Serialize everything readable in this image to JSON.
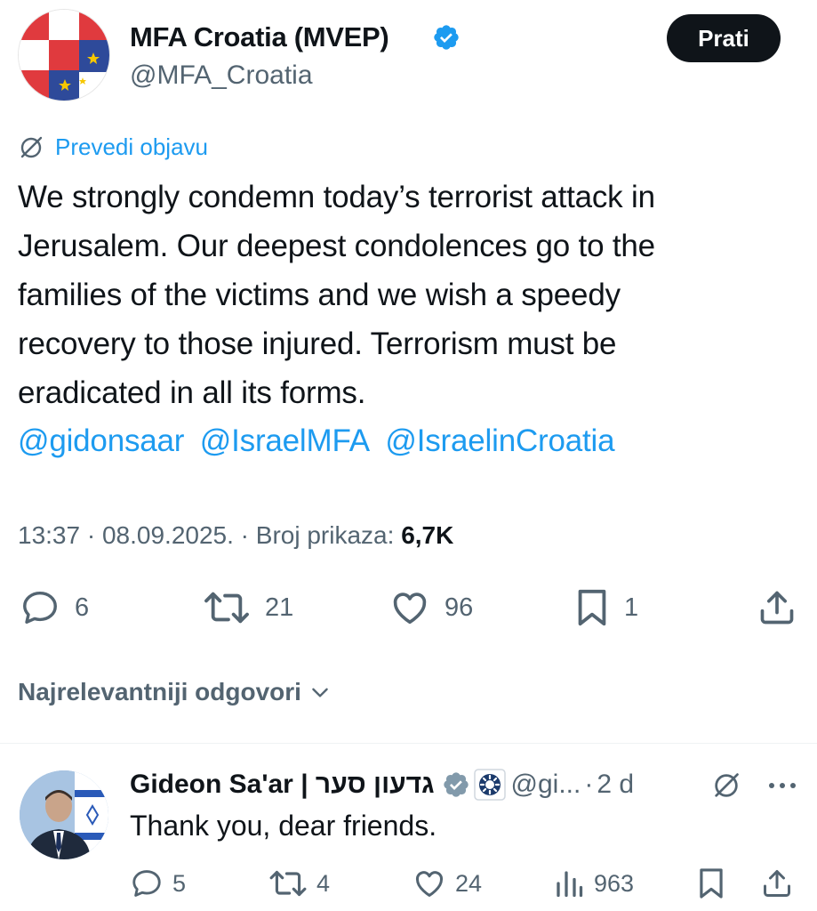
{
  "post": {
    "author_name": "MFA Croatia (MVEP)",
    "author_handle": "@MFA_Croatia",
    "follow_label": "Prati",
    "translate_label": "Prevedi objavu",
    "text_lines": [
      "We strongly condemn today’s terrorist attack in",
      "Jerusalem. Our deepest condolences go to the",
      "families of the victims and we wish a speedy",
      "recovery to those injured. Terrorism must be",
      "eradicated in all its forms."
    ],
    "mentions": [
      "@gidonsaar",
      "@IsraelMFA",
      "@IsraelinCroatia"
    ],
    "time": "13:37",
    "date": "08.09.2025.",
    "views_label": "Broj prikaza:",
    "views_count": "6,7K",
    "stats": {
      "replies": "6",
      "reposts": "21",
      "likes": "96",
      "bookmarks": "1"
    }
  },
  "replies_section": {
    "sort_label": "Najrelevantniji odgovori"
  },
  "reply": {
    "author_name": "Gideon Sa'ar | גדעון סער",
    "author_handle": "@gi...",
    "separator": "·",
    "time": "2 d",
    "text": "Thank you, dear friends.",
    "stats": {
      "replies": "5",
      "reposts": "4",
      "likes": "24",
      "views": "963"
    }
  },
  "colors": {
    "accent": "#1d9bf0",
    "text": "#0f1419",
    "secondary": "#536471",
    "button_bg": "#0f1419"
  }
}
